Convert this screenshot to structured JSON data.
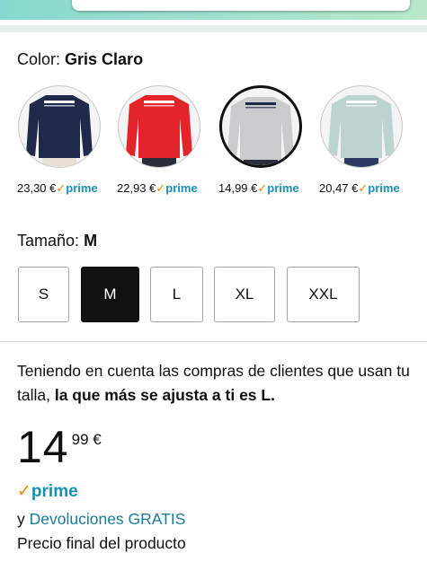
{
  "color": {
    "label": "Color:",
    "selected": "Gris Claro"
  },
  "swatches": [
    {
      "color": "#1f2a4a",
      "price": "23,30 €",
      "prime": "prime"
    },
    {
      "color": "#e3242b",
      "price": "22,93 €",
      "prime": "prime"
    },
    {
      "color": "#c9cbcd",
      "price": "14,99 €",
      "prime": "prime"
    },
    {
      "color": "#bcd3cf",
      "price": "20,47 €",
      "prime": "prime"
    }
  ],
  "prime_check": "✓",
  "size": {
    "label": "Tamaño:",
    "selected": "M",
    "options": [
      "S",
      "M",
      "L",
      "XL",
      "XXL"
    ]
  },
  "fit": {
    "text": "Teniendo en cuenta las compras de clientes que usan tu talla,",
    "bold": "la que más se ajusta a ti es L."
  },
  "price": {
    "whole": "14",
    "fraction": "99",
    "currency": "€"
  },
  "prime_badge": "prime",
  "returns": {
    "prefix": "y",
    "link": "Devoluciones GRATIS"
  },
  "final_price_note": "Precio final del producto",
  "colors": {
    "prime_blue": "#1a8fb5",
    "check_orange": "#f08804",
    "link": "#1a7a99"
  }
}
